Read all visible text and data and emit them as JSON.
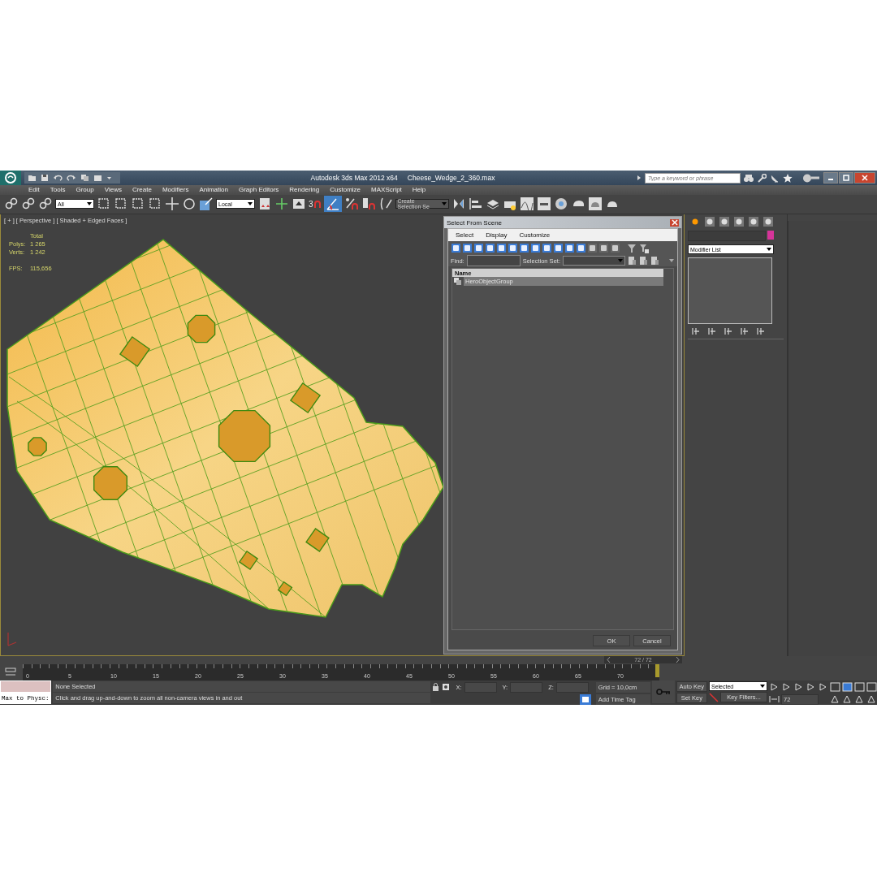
{
  "title_bar": {
    "app_title": "Autodesk 3ds Max  2012 x64",
    "file_name": "Cheese_Wedge_2_360.max",
    "search": {
      "placeholder": "Type a keyword or phrase"
    }
  },
  "menu": [
    "Edit",
    "Tools",
    "Group",
    "Views",
    "Create",
    "Modifiers",
    "Animation",
    "Graph Editors",
    "Rendering",
    "Customize",
    "MAXScript",
    "Help"
  ],
  "toolbar": {
    "selection_filter": "All",
    "coordinate_system": "Local",
    "snap_label": "3",
    "named_selection": "Create Selection Se",
    "angle_snap_on": true
  },
  "viewport": {
    "label": "[ + ] [ Perspective ] [ Shaded + Edged Faces ]",
    "stats_header": "Total",
    "stats": [
      {
        "label": "Polys:",
        "value": "1 265"
      },
      {
        "label": "Verts:",
        "value": "1 242"
      },
      {
        "label": "FPS:",
        "value": "115,656"
      }
    ]
  },
  "dialog": {
    "title": "Select From Scene",
    "menu": [
      "Select",
      "Display",
      "Customize"
    ],
    "filter_toggles": [
      {
        "on": true
      },
      {
        "on": true
      },
      {
        "on": true
      },
      {
        "on": true
      },
      {
        "on": true
      },
      {
        "on": true
      },
      {
        "on": true
      },
      {
        "on": true
      },
      {
        "on": true
      },
      {
        "on": true
      },
      {
        "on": true
      },
      {
        "on": true
      },
      {
        "on": false
      },
      {
        "on": false
      },
      {
        "on": false
      }
    ],
    "find_label": "Find:",
    "selection_set_label": "Selection Set:",
    "column": "Name",
    "rows": [
      {
        "name": "HeroObjectGroup",
        "selected": true
      }
    ],
    "buttons": [
      "OK",
      "Cancel"
    ]
  },
  "command_panel": {
    "modifier_list": "Modifier List"
  },
  "timeline": {
    "frame": "72 / 72",
    "level": 1,
    "ticks": [
      "0",
      "5",
      "10",
      "15",
      "20",
      "25",
      "30",
      "35",
      "40",
      "45",
      "50",
      "55",
      "60",
      "65",
      "70"
    ]
  },
  "status": {
    "script_label": "Max to Physc:",
    "selection": "None Selected",
    "prompt": "Click and drag up-and-down to zoom all non-camera views in and out",
    "x_label": "X:",
    "y_label": "Y:",
    "z_label": "Z:",
    "grid": "Grid = 10,0cm",
    "add_time_tag": "Add Time Tag",
    "auto_key": "Auto Key",
    "set_key": "Set Key",
    "key_mode": "Selected",
    "key_filters": "Key Filters...",
    "current_frame": "72"
  }
}
